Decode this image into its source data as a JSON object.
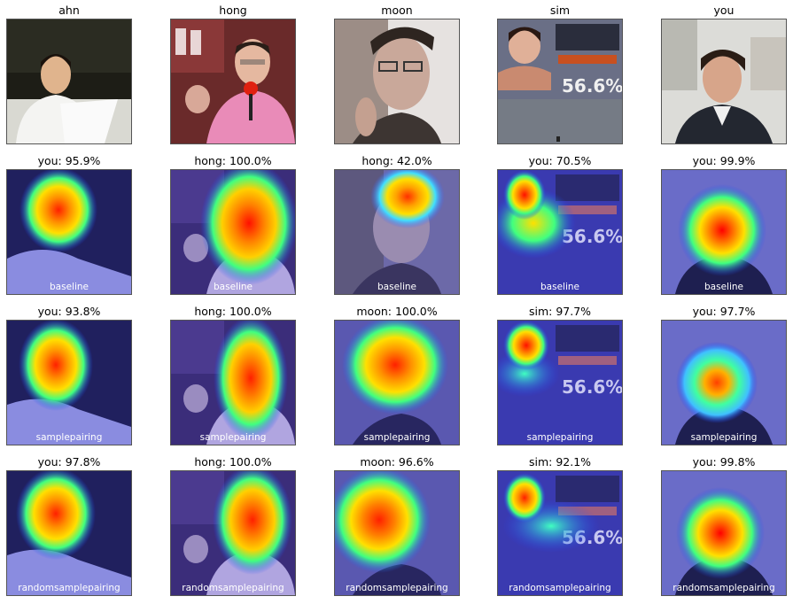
{
  "rows": [
    {
      "method": "",
      "cells": [
        {
          "label": "ahn"
        },
        {
          "label": "hong"
        },
        {
          "label": "moon"
        },
        {
          "label": "sim"
        },
        {
          "label": "you"
        }
      ]
    },
    {
      "method": "baseline",
      "cells": [
        {
          "label": "you: 95.9%"
        },
        {
          "label": "hong: 100.0%"
        },
        {
          "label": "hong: 42.0%"
        },
        {
          "label": "you: 70.5%"
        },
        {
          "label": "you: 99.9%"
        }
      ]
    },
    {
      "method": "samplepairing",
      "cells": [
        {
          "label": "you: 93.8%"
        },
        {
          "label": "hong: 100.0%"
        },
        {
          "label": "moon: 100.0%"
        },
        {
          "label": "sim: 97.7%"
        },
        {
          "label": "you: 97.7%"
        }
      ]
    },
    {
      "method": "randomsamplepairing",
      "cells": [
        {
          "label": "you: 97.8%"
        },
        {
          "label": "hong: 100.0%"
        },
        {
          "label": "moon: 96.6%"
        },
        {
          "label": "sim: 92.1%"
        },
        {
          "label": "you: 99.8%"
        }
      ]
    }
  ],
  "photo_overlay_text": {
    "sim_percent": "56.6%"
  },
  "colors": {
    "heat_hot": "#ff2000",
    "heat_warm": "#ffe000",
    "heat_mid": "#40ff80",
    "heat_cool": "#2080ff",
    "heat_cold": "#202080"
  }
}
